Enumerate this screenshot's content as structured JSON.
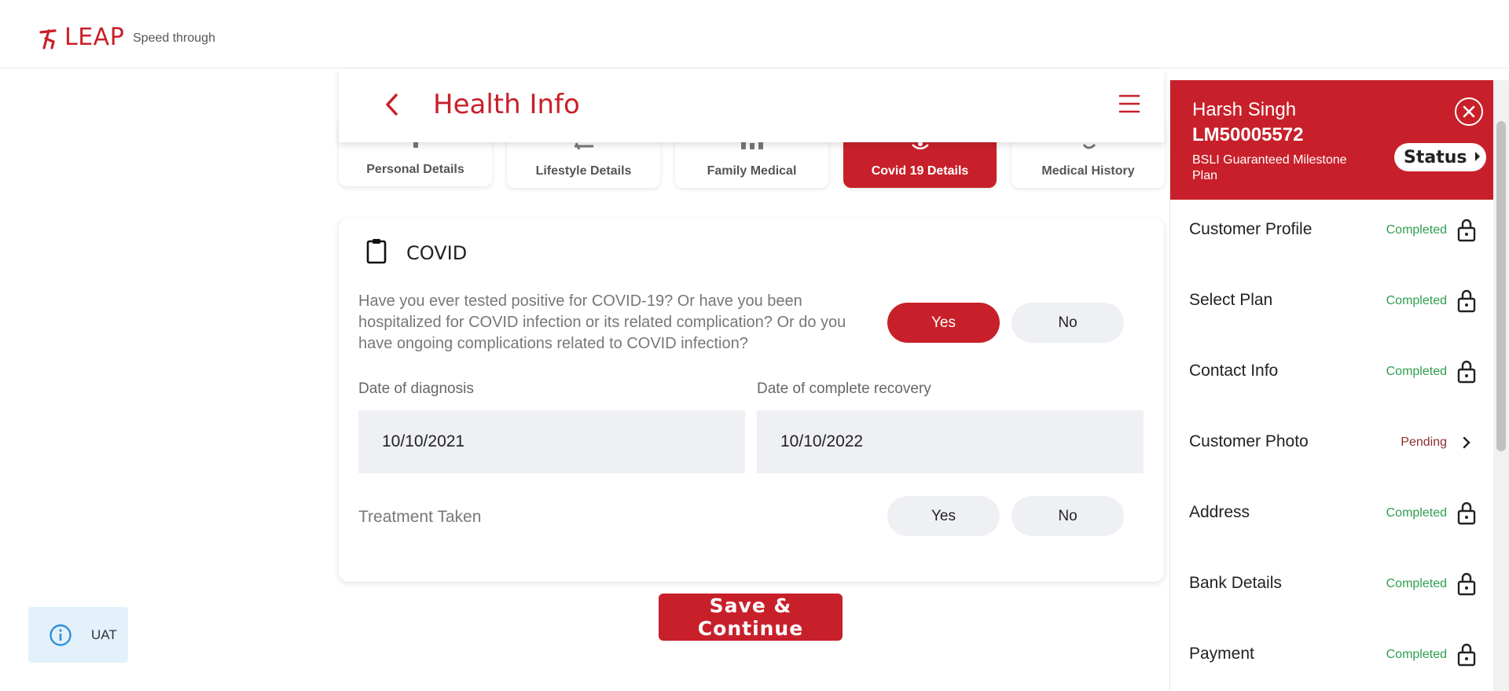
{
  "header": {
    "brand": "LEAP",
    "tagline": "Speed through"
  },
  "page": {
    "title": "Health Info"
  },
  "tabs": [
    {
      "label": "Personal Details",
      "icon": "person-icon"
    },
    {
      "label": "Lifestyle Details",
      "icon": "lifestyle-icon"
    },
    {
      "label": "Family Medical",
      "icon": "family-icon"
    },
    {
      "label": "Covid 19 Details",
      "icon": "virus-icon",
      "active": true
    },
    {
      "label": "Medical History",
      "icon": "medical-history-icon"
    }
  ],
  "covid": {
    "title": "COVID",
    "question": "Have you ever tested positive for COVID-19? Or have you been hospitalized for COVID infection or its related complication? Or do you have ongoing complications related to COVID infection?",
    "yes_label": "Yes",
    "no_label": "No",
    "selected": "Yes",
    "diagnosis_label": "Date of diagnosis",
    "diagnosis_value": "10/10/2021",
    "recovery_label": "Date of complete recovery",
    "recovery_value": "10/10/2022",
    "treatment_label": "Treatment Taken",
    "treatment_yes": "Yes",
    "treatment_no": "No"
  },
  "save_label": "Save & Continue",
  "env_badge": "UAT",
  "profile": {
    "name": "Harsh Singh",
    "id": "LM50005572",
    "plan": "BSLI Guaranteed Milestone Plan",
    "status_label": "Status"
  },
  "steps": [
    {
      "label": "Customer Profile",
      "status": "Completed",
      "icon": "lock-icon"
    },
    {
      "label": "Select Plan",
      "status": "Completed",
      "icon": "lock-icon"
    },
    {
      "label": "Contact Info",
      "status": "Completed",
      "icon": "lock-icon"
    },
    {
      "label": "Customer Photo",
      "status": "Pending",
      "icon": "chevron-right-icon"
    },
    {
      "label": "Address",
      "status": "Completed",
      "icon": "lock-icon"
    },
    {
      "label": "Bank Details",
      "status": "Completed",
      "icon": "lock-icon"
    },
    {
      "label": "Payment",
      "status": "Completed",
      "icon": "lock-icon"
    }
  ],
  "colors": {
    "brand": "#c8202a",
    "completed": "#2e9e4f",
    "pending": "#8a2f2f",
    "field_bg": "#eef0f4"
  }
}
